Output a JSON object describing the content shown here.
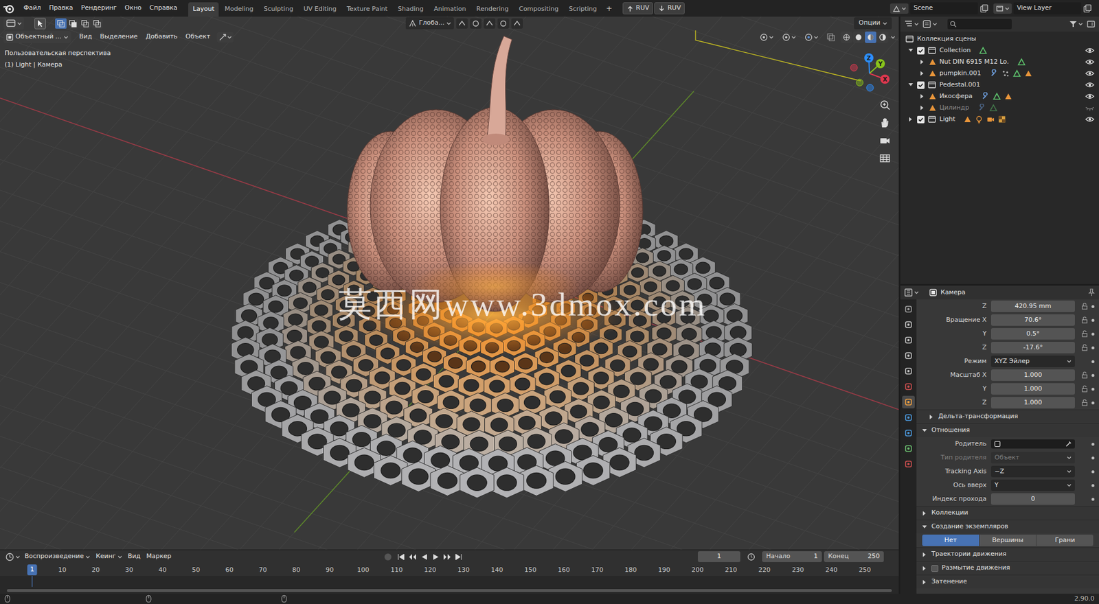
{
  "menu": [
    "Файл",
    "Правка",
    "Рендеринг",
    "Окно",
    "Справка"
  ],
  "workspaces": [
    {
      "label": "Layout",
      "selected": true
    },
    {
      "label": "Modeling",
      "selected": false
    },
    {
      "label": "Sculpting",
      "selected": false
    },
    {
      "label": "UV Editing",
      "selected": false
    },
    {
      "label": "Texture Paint",
      "selected": false
    },
    {
      "label": "Shading",
      "selected": false
    },
    {
      "label": "Animation",
      "selected": false
    },
    {
      "label": "Rendering",
      "selected": false
    },
    {
      "label": "Compositing",
      "selected": false
    },
    {
      "label": "Scripting",
      "selected": false
    }
  ],
  "add_workspace": "+",
  "sync": [
    {
      "label": "RUV",
      "kind": "push"
    },
    {
      "label": "RUV",
      "kind": "pull"
    }
  ],
  "scene": "Scene",
  "view_layer": "View Layer",
  "tool_settings": {
    "select_modes": [
      {
        "selected": true
      },
      {
        "selected": false
      },
      {
        "selected": false
      },
      {
        "selected": false
      }
    ],
    "orientation": "Глоба...",
    "options": "Опции"
  },
  "viewport_header": {
    "mode": "Объектный ...",
    "menus": [
      "Вид",
      "Выделение",
      "Добавить",
      "Объект"
    ],
    "shading_modes": [
      {
        "kind": "wireframe",
        "selected": false
      },
      {
        "kind": "solid",
        "selected": false
      },
      {
        "kind": "material",
        "selected": true
      },
      {
        "kind": "rendered",
        "selected": false
      }
    ]
  },
  "viewport": {
    "view_name": "Пользовательская перспектива",
    "active_object": "(1) Light | Камера",
    "watermark": "莫西网www.3dmox.com",
    "gizmo_axes": [
      {
        "label": "X",
        "color": "#e0384f"
      },
      {
        "label": "Y",
        "color": "#8ac41b"
      },
      {
        "label": "Z",
        "color": "#2c8fff"
      }
    ]
  },
  "outliner": {
    "root": "Коллекция сцены",
    "items": [
      {
        "label": "Collection",
        "depth": 0,
        "kind": "collection",
        "expanded": true,
        "checked": true,
        "visible": true,
        "badges": [
          "mesh"
        ]
      },
      {
        "label": "Nut DIN 6915 M12 Lo.",
        "depth": 1,
        "kind": "object",
        "expanded": false,
        "visible": true,
        "badges": [
          "mesh"
        ]
      },
      {
        "label": "pumpkin.001",
        "depth": 1,
        "kind": "object",
        "expanded": false,
        "visible": true,
        "badges": [
          "modifier",
          "particles",
          "mesh",
          "object"
        ]
      },
      {
        "label": "Pedestal.001",
        "depth": 0,
        "kind": "collection",
        "expanded": true,
        "checked": true,
        "visible": true,
        "badges": []
      },
      {
        "label": "Икосфера",
        "depth": 1,
        "kind": "object",
        "expanded": false,
        "visible": true,
        "badges": [
          "modifier",
          "mesh",
          "object"
        ]
      },
      {
        "label": "Цилиндр",
        "depth": 1,
        "kind": "object",
        "expanded": false,
        "visible": false,
        "badges": [
          "modifier",
          "mesh"
        ]
      },
      {
        "label": "Light",
        "depth": 0,
        "kind": "collection",
        "expanded": false,
        "checked": true,
        "visible": true,
        "badges": [
          "object",
          "light",
          "camera",
          "texture"
        ]
      }
    ]
  },
  "properties": {
    "object": "Камера",
    "tabs": [
      {
        "selected": false,
        "color": "#a0a0a0"
      },
      {
        "selected": false,
        "color": "#c8c8c8"
      },
      {
        "selected": false,
        "color": "#c8c8c8"
      },
      {
        "selected": false,
        "color": "#c8c8c8"
      },
      {
        "selected": false,
        "color": "#c8c8c8"
      },
      {
        "selected": false,
        "color": "#d05050"
      },
      {
        "selected": true,
        "color": "#f0a040"
      },
      {
        "selected": false,
        "color": "#4c9be0"
      },
      {
        "selected": false,
        "color": "#4c9be0"
      },
      {
        "selected": false,
        "color": "#6cc070"
      },
      {
        "selected": false,
        "color": "#d05050"
      }
    ],
    "rows": [
      {
        "kind": "field",
        "label": "Z",
        "value": "420.95 mm",
        "disabled": false,
        "locked": false
      },
      {
        "kind": "field",
        "label": "Вращение X",
        "value": "70.6°",
        "disabled": false,
        "locked": false
      },
      {
        "kind": "field",
        "label": "Y",
        "value": "0.5°",
        "disabled": false,
        "locked": false
      },
      {
        "kind": "field",
        "label": "Z",
        "value": "-17.6°",
        "disabled": false,
        "locked": false
      },
      {
        "kind": "dropdown",
        "label": "Режим",
        "value": "XYZ Эйлер",
        "disabled": false
      },
      {
        "kind": "field",
        "label": "Масштаб X",
        "value": "1.000",
        "disabled": false,
        "locked": false
      },
      {
        "kind": "field",
        "label": "Y",
        "value": "1.000",
        "disabled": false,
        "locked": false
      },
      {
        "kind": "field",
        "label": "Z",
        "value": "1.000",
        "disabled": false,
        "locked": false
      },
      {
        "kind": "panel",
        "label": "Дельта-трансформация",
        "expanded": false,
        "sub": true
      },
      {
        "kind": "panel",
        "label": "Отношения",
        "expanded": true,
        "sub": false
      },
      {
        "kind": "picker",
        "label": "Родитель",
        "value": "",
        "disabled": false
      },
      {
        "kind": "dropdown",
        "label": "Тип родителя",
        "value": "Объект",
        "disabled": true
      },
      {
        "kind": "dropdown",
        "label": "Tracking Axis",
        "value": "−Z",
        "disabled": false
      },
      {
        "kind": "dropdown",
        "label": "Ось вверх",
        "value": "Y",
        "disabled": false
      },
      {
        "kind": "field",
        "label": "Индекс прохода",
        "value": "0",
        "disabled": false
      },
      {
        "kind": "panel",
        "label": "Коллекции",
        "expanded": false,
        "sub": false
      },
      {
        "kind": "panel",
        "label": "Создание экземпляров",
        "expanded": true,
        "sub": false
      },
      {
        "kind": "segmented",
        "options": [
          {
            "label": "Нет",
            "selected": true
          },
          {
            "label": "Вершины",
            "selected": false
          },
          {
            "label": "Грани",
            "selected": false
          }
        ]
      },
      {
        "kind": "panel",
        "label": "Траектории движения",
        "expanded": false,
        "sub": false
      },
      {
        "kind": "panel",
        "label": "Размытие движения",
        "expanded": false,
        "sub": false,
        "checked": false
      },
      {
        "kind": "panel",
        "label": "Затенение",
        "expanded": false,
        "sub": false
      }
    ]
  },
  "timeline": {
    "menus": [
      "Воспроизведение",
      "Кеинг",
      "Вид",
      "Маркер"
    ],
    "frame": "1",
    "start_label": "Начало",
    "start": "1",
    "end_label": "Конец",
    "end": "250",
    "playhead": "1",
    "ticks": [
      "10",
      "20",
      "30",
      "40",
      "50",
      "60",
      "70",
      "80",
      "90",
      "100",
      "110",
      "120",
      "130",
      "140",
      "150",
      "160",
      "170",
      "180",
      "190",
      "200",
      "210",
      "220",
      "230",
      "240",
      "250"
    ]
  },
  "status_bar": {
    "version": "2.90.0"
  }
}
